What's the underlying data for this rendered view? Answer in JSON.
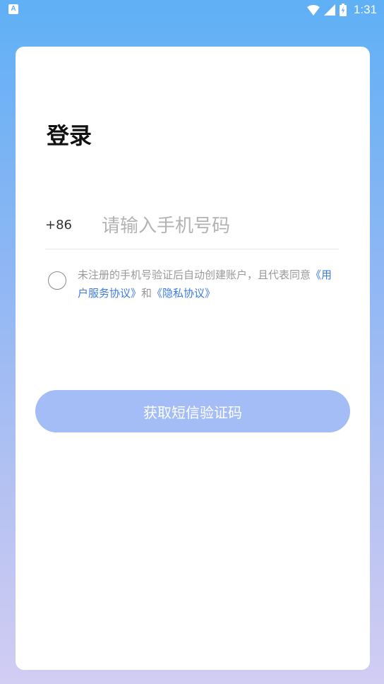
{
  "status_bar": {
    "app_icon_glyph": "A",
    "time": "1:31",
    "icons": [
      "wifi-icon",
      "signal-icon",
      "battery-charging-icon"
    ]
  },
  "login": {
    "title": "登录",
    "country_code": "+86",
    "phone_placeholder": "请输入手机号码",
    "phone_value": "",
    "agreement": {
      "prefix": "未注册的手机号验证后自动创建账户，且代表同意",
      "user_agreement": "《用户服务协议》",
      "conjunction": "和",
      "privacy_agreement": "《隐私协议》"
    },
    "submit_label": "获取短信验证码"
  },
  "colors": {
    "background_top": "#5fb0f5",
    "background_bottom": "#d2cdf3",
    "link": "#3d7be0",
    "button": "#a4bdf6"
  }
}
